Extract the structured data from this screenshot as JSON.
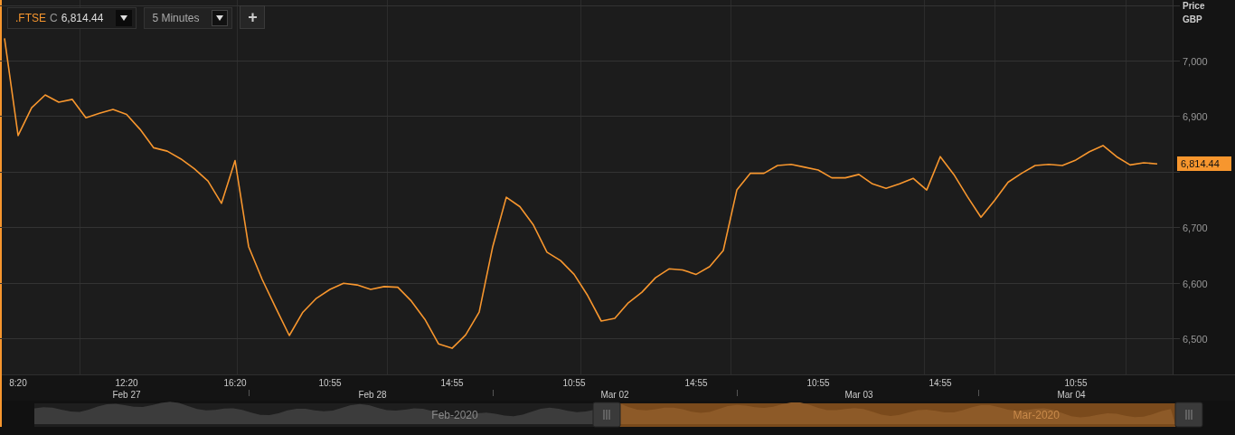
{
  "toolbar": {
    "symbol": {
      "prefix": "C",
      "price": "6,814.44"
    },
    "interval": "5 Minutes",
    "add_button": "+"
  },
  "axis_header": {
    "title": "Price",
    "unit": "GBP"
  },
  "last_price_tag": "6,814.44",
  "chart_data": {
    "type": "line",
    "ylim": [
      6435,
      7109
    ],
    "yticks": [
      {
        "value": 6500,
        "label": "6,500"
      },
      {
        "value": 6600,
        "label": "6,600"
      },
      {
        "value": 6700,
        "label": "6,700"
      },
      {
        "value": 6900,
        "label": "6,900"
      },
      {
        "value": 7000,
        "label": "7,000"
      }
    ],
    "categories": [
      null,
      "8:20",
      null,
      null,
      null,
      null,
      null,
      null,
      null,
      "12:20",
      null,
      null,
      null,
      null,
      null,
      null,
      null,
      "16:20",
      null,
      null,
      null,
      null,
      null,
      null,
      "10:55",
      null,
      null,
      null,
      null,
      null,
      null,
      null,
      null,
      "14:55",
      null,
      null,
      null,
      null,
      null,
      null,
      null,
      null,
      "10:55",
      null,
      null,
      null,
      null,
      null,
      null,
      null,
      null,
      "14:55",
      null,
      null,
      null,
      null,
      null,
      null,
      null,
      null,
      "10:55",
      null,
      null,
      null,
      null,
      null,
      null,
      null,
      null,
      "14:55",
      null,
      null,
      null,
      null,
      null,
      null,
      null,
      null,
      null,
      "10:55",
      null,
      null,
      null,
      null,
      null,
      null
    ],
    "series": [
      {
        "name": ".FTSE",
        "color": "#f7962e",
        "values": [
          7040,
          6865,
          6915,
          6938,
          6925,
          6930,
          6897,
          6905,
          6912,
          6903,
          6876,
          6843,
          6837,
          6823,
          6805,
          6783,
          6743,
          6820,
          6665,
          6606,
          6555,
          6505,
          6547,
          6572,
          6588,
          6599,
          6596,
          6588,
          6593,
          6592,
          6567,
          6534,
          6490,
          6482,
          6506,
          6547,
          6665,
          6754,
          6737,
          6704,
          6655,
          6640,
          6615,
          6577,
          6531,
          6536,
          6564,
          6583,
          6609,
          6625,
          6623,
          6615,
          6629,
          6658,
          6767,
          6797,
          6797,
          6811,
          6813,
          6808,
          6803,
          6789,
          6789,
          6795,
          6778,
          6770,
          6778,
          6788,
          6767,
          6827,
          6795,
          6755,
          6718,
          6748,
          6781,
          6797,
          6811,
          6813,
          6811,
          6821,
          6836,
          6847,
          6827,
          6812,
          6816,
          6814
        ]
      }
    ]
  },
  "time_axis": {
    "dates": [
      "Feb 27",
      "Feb 28",
      "Mar 02",
      "Mar 03",
      "Mar 04"
    ]
  },
  "navigator": {
    "periods": [
      {
        "label": "Feb-2020",
        "selected": false
      },
      {
        "label": "Mar-2020",
        "selected": true
      }
    ]
  }
}
